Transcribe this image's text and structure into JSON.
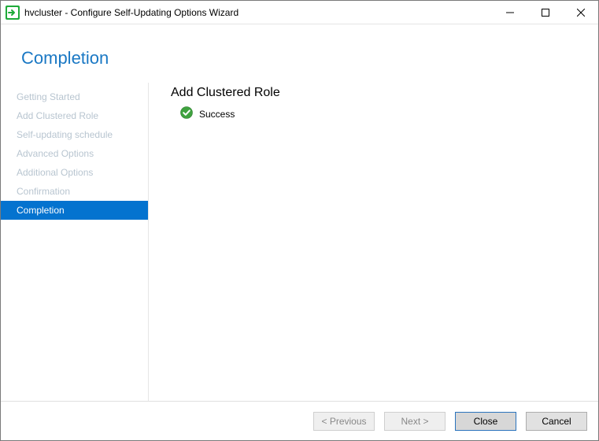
{
  "titlebar": {
    "text": "hvcluster - Configure Self-Updating Options Wizard"
  },
  "heading": "Completion",
  "sidebar": {
    "items": [
      {
        "label": "Getting Started",
        "active": false
      },
      {
        "label": "Add Clustered Role",
        "active": false
      },
      {
        "label": "Self-updating schedule",
        "active": false
      },
      {
        "label": "Advanced Options",
        "active": false
      },
      {
        "label": "Additional Options",
        "active": false
      },
      {
        "label": "Confirmation",
        "active": false
      },
      {
        "label": "Completion",
        "active": true
      }
    ]
  },
  "main": {
    "section_title": "Add Clustered Role",
    "status_text": "Success"
  },
  "buttons": {
    "previous": "< Previous",
    "next": "Next >",
    "close": "Close",
    "cancel": "Cancel"
  }
}
